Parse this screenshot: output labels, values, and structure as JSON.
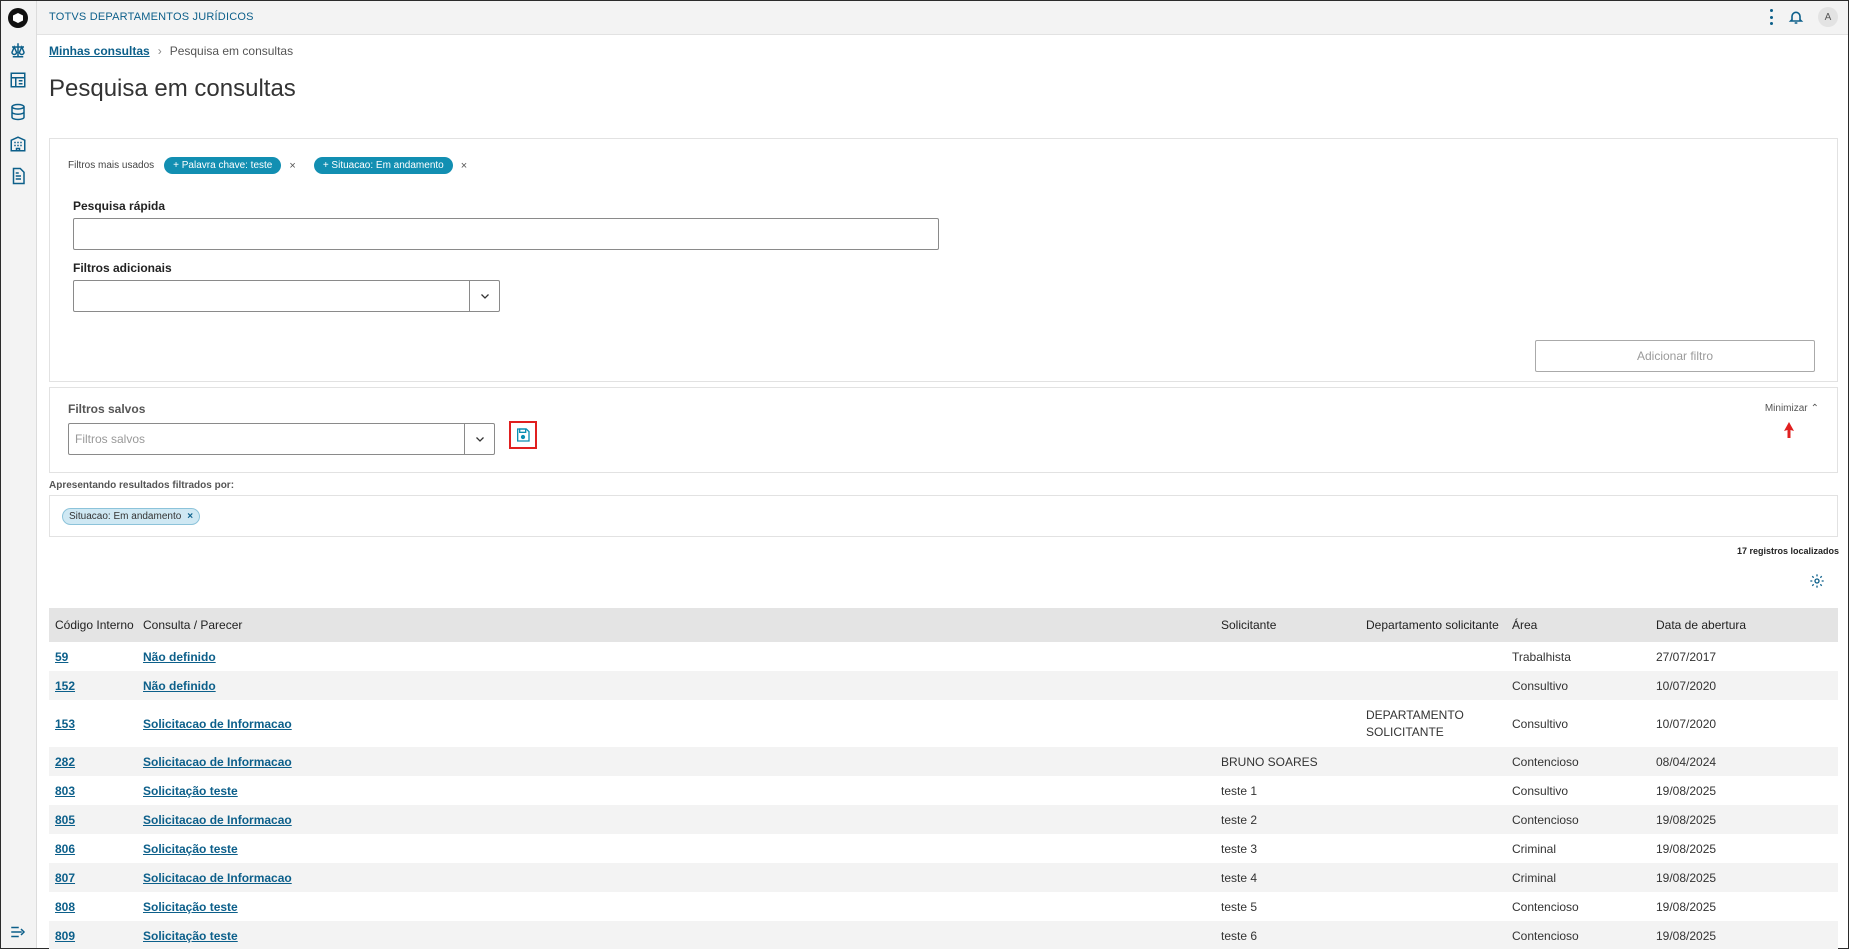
{
  "app": {
    "title": "TOTVS DEPARTAMENTOS JURÍDICOS",
    "avatar_initial": "A"
  },
  "sidebar": {
    "icons": [
      "scale-icon",
      "dashboard-icon",
      "database-icon",
      "building-icon",
      "document-icon",
      "expand-menu-icon"
    ]
  },
  "breadcrumb": {
    "parent": "Minhas consultas",
    "current": "Pesquisa em consultas"
  },
  "page": {
    "title": "Pesquisa em consultas"
  },
  "filters": {
    "most_used_label": "Filtros mais usados",
    "chips": [
      "+ Palavra chave: teste",
      "+ Situacao: Em andamento"
    ],
    "chip_remove": "×",
    "quick_search_label": "Pesquisa rápida",
    "quick_search_value": "",
    "additional_label": "Filtros adicionais",
    "additional_value": "",
    "add_button": "Adicionar filtro"
  },
  "saved_filters": {
    "title": "Filtros salvos",
    "placeholder": "Filtros salvos",
    "minimize_label": "Minimizar"
  },
  "results": {
    "label": "Apresentando resultados filtrados por:",
    "active_chip": "Situacao: Em andamento",
    "active_chip_remove": "×",
    "count_text": "17 registros localizados"
  },
  "table": {
    "headers": [
      "Código Interno",
      "Consulta / Parecer",
      "Solicitante",
      "Departamento solicitante",
      "Área",
      "Data de abertura"
    ],
    "rows": [
      {
        "codigo": "59",
        "consulta": "Não definido",
        "solicitante": "",
        "departamento": "",
        "area": "Trabalhista",
        "data": "27/07/2017"
      },
      {
        "codigo": "152",
        "consulta": "Não definido",
        "solicitante": "",
        "departamento": "",
        "area": "Consultivo",
        "data": "10/07/2020"
      },
      {
        "codigo": "153",
        "consulta": "Solicitacao de Informacao",
        "solicitante": "",
        "departamento": "DEPARTAMENTO SOLICITANTE",
        "area": "Consultivo",
        "data": "10/07/2020"
      },
      {
        "codigo": "282",
        "consulta": "Solicitacao de Informacao",
        "solicitante": "BRUNO SOARES",
        "departamento": "",
        "area": "Contencioso",
        "data": "08/04/2024"
      },
      {
        "codigo": "803",
        "consulta": "Solicitação teste",
        "solicitante": "teste 1",
        "departamento": "",
        "area": "Consultivo",
        "data": "19/08/2025"
      },
      {
        "codigo": "805",
        "consulta": "Solicitacao de Informacao",
        "solicitante": "teste 2",
        "departamento": "",
        "area": "Contencioso",
        "data": "19/08/2025"
      },
      {
        "codigo": "806",
        "consulta": "Solicitação teste",
        "solicitante": "teste 3",
        "departamento": "",
        "area": "Criminal",
        "data": "19/08/2025"
      },
      {
        "codigo": "807",
        "consulta": "Solicitacao de Informacao",
        "solicitante": "teste 4",
        "departamento": "",
        "area": "Criminal",
        "data": "19/08/2025"
      },
      {
        "codigo": "808",
        "consulta": "Solicitação teste",
        "solicitante": "teste 5",
        "departamento": "",
        "area": "Contencioso",
        "data": "19/08/2025"
      },
      {
        "codigo": "809",
        "consulta": "Solicitação teste",
        "solicitante": "teste 6",
        "departamento": "",
        "area": "Contencioso",
        "data": "19/08/2025"
      }
    ]
  },
  "colors": {
    "accent": "#0c5f8a",
    "chip": "#128fb2",
    "highlight": "#e02020"
  }
}
